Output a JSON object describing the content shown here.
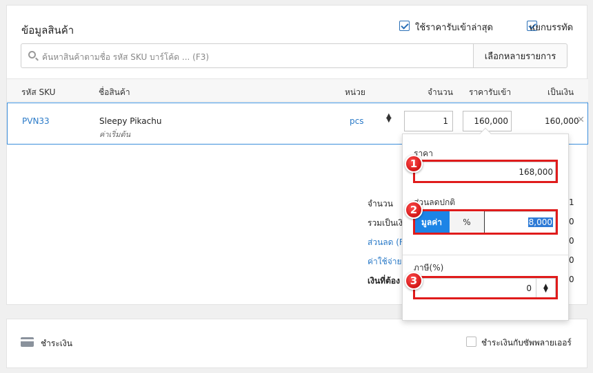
{
  "product_info": {
    "title": "ข้อมูลสินค้า",
    "use_latest_price_label": "ใช้ราคารับเข้าล่าสุด",
    "separate_lines_label": "แยกบรรทัด",
    "search_placeholder": "ค้นหาสินค้าตามชื่อ รหัส SKU บาร์โค้ด ... (F3)",
    "select_multiple_label": "เลือกหลายรายการ"
  },
  "table": {
    "headers": {
      "sku": "รหัส SKU",
      "name": "ชื่อสินค้า",
      "unit": "หน่วย",
      "qty": "จำนวน",
      "price": "ราคารับเข้า",
      "amount": "เป็นเงิน"
    },
    "rows": [
      {
        "sku": "PVN33",
        "name": "Sleepy Pikachu",
        "variant": "ค่าเริ่มต้น",
        "unit": "pcs",
        "qty": "1",
        "price": "160,000",
        "amount": "160,000"
      }
    ]
  },
  "summary": {
    "qty_label": "จำนวน",
    "qty_value": "1",
    "subtotal_label": "รวมเป็นเงิ",
    "subtotal_value": "0",
    "discount_label": "ส่วนลด (F",
    "discount_value": "0",
    "expense_label": "ค่าใช้จ่าย",
    "expense_value": "0",
    "total_label": "เงินที่ต้อง",
    "total_value": "0"
  },
  "popover": {
    "price_label": "ราคา",
    "price_value": "168,000",
    "discount_label": "ส่วนลดปกติ",
    "mode_value": "มูลค่า",
    "mode_percent": "%",
    "discount_value": "8,000",
    "tax_label": "ภาษี(%)",
    "tax_value": "0"
  },
  "annotations": [
    "1",
    "2",
    "3"
  ],
  "payment": {
    "pay_label": "ชำระเงิน",
    "pay_supplier_label": "ชำระเงินกับซัพพลายเออร์"
  }
}
